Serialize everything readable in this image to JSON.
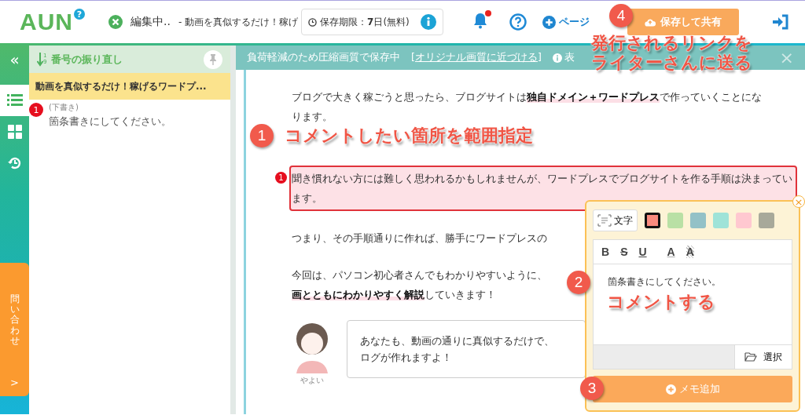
{
  "header": {
    "logo": "AUN",
    "logo_badge": "?",
    "status": "編集中..",
    "title": "- 動画を真似するだけ！稼げ",
    "expiry": "保存期限：**7**日(無料)",
    "notification_dot": true,
    "page_link": "ページ",
    "share_button": "保存して共有"
  },
  "rail": {
    "collapse": "«",
    "items": [
      {
        "kind": "list",
        "selected": true
      },
      {
        "kind": "grid",
        "selected": false
      },
      {
        "kind": "history",
        "selected": false
      }
    ],
    "contact_tab": "問い合わせ",
    "contact_arrow": ">"
  },
  "panel": {
    "header": "番号の振り直し",
    "sort_digits": [
      "1",
      "9"
    ],
    "document_title": "動画を真似するだけ！稼げるワードプ...",
    "memos": [
      {
        "number": "1",
        "status": "(下書き)",
        "text": "箇条書きにしてください。"
      }
    ]
  },
  "banner": {
    "message": "負荷軽減のため圧縮画質で保存中",
    "link": "[オリジナル画質に近づける]",
    "info": "表",
    "close": "×"
  },
  "article": {
    "paragraphs": [
      {
        "text": "ブログで大きく稼ごうと思ったら、ブログサイトは**独自ドメイン＋ワードプレス**で作っていくことになります。",
        "highlighted": false
      },
      {
        "text": "聞き慣れない方には難しく思われるかもしれませんが、ワードプレスでブログサイトを作る手順は決まっています。",
        "highlighted": true,
        "memo_number": "1"
      },
      {
        "text": "つまり、その手順通りに作れば、勝手にワードプレスの",
        "highlighted": false
      },
      {
        "text": "今回は、パソコン初心者さんでもわかりやすいように、",
        "highlighted": false
      },
      {
        "text": "**画とともにわかりやすく解説**していきます！",
        "highlighted": false
      }
    ],
    "speech": {
      "speaker": "やよい",
      "lines": [
        "あなたも、動画の通りに真似するだけで、",
        "ログが作れますよ！"
      ]
    }
  },
  "memo_editor": {
    "close": "×",
    "text_button": "文字",
    "colors": [
      {
        "color": "#f98b7e",
        "selected": true
      },
      {
        "color": "#b9e0a5",
        "selected": false
      },
      {
        "color": "#93c1c7",
        "selected": false
      },
      {
        "color": "#9fe3d8",
        "selected": false
      },
      {
        "color": "#ffc8d0",
        "selected": false
      },
      {
        "color": "#a8a99a",
        "selected": false
      }
    ],
    "format_buttons": [
      "B",
      "S",
      "U",
      "A",
      "A"
    ],
    "text": "箇条書きにしてください。",
    "select_button": "選択",
    "add_button": "メモ追加"
  },
  "annotations": [
    {
      "number": "4",
      "lines": [
        "発行されるリンクを",
        "ライターさんに送る"
      ]
    },
    {
      "number": "1",
      "lines": [
        "コメントしたい箇所を範囲指定"
      ]
    },
    {
      "number": "2",
      "lines": [
        "コメントする"
      ]
    },
    {
      "number": "3"
    }
  ]
}
